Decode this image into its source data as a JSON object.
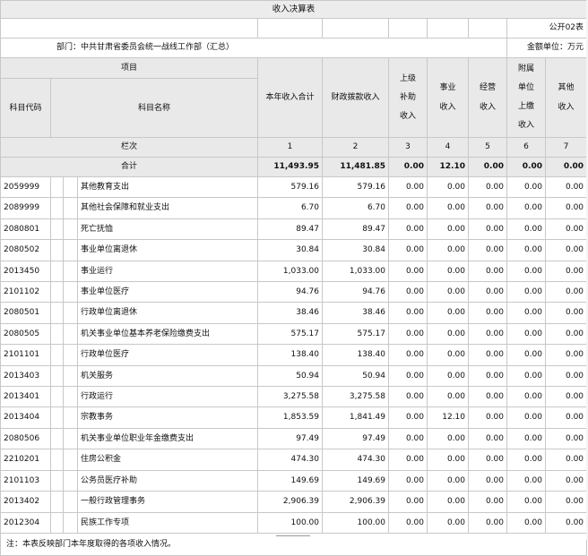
{
  "title": "收入决算表",
  "form_no": "公开02表",
  "department": "部门：中共甘肃省委员会统一战线工作部（汇总）",
  "unit": "金额单位：万元",
  "headers": {
    "item": "项目",
    "code": "科目代码",
    "name": "科目名称",
    "total": "本年收入合计",
    "fiscal": "财政拨款收入",
    "superior": "上级补助收入",
    "business": "事业收入",
    "operating": "经营收入",
    "affiliate": "附属单位上缴收入",
    "other": "其他收入"
  },
  "column_index_label": "栏次",
  "column_index": [
    "1",
    "2",
    "3",
    "4",
    "5",
    "6",
    "7"
  ],
  "total_row": {
    "label": "合计",
    "values": [
      "11,493.95",
      "11,481.85",
      "0.00",
      "12.10",
      "0.00",
      "0.00",
      "0.00"
    ]
  },
  "rows": [
    {
      "code": "2059999",
      "name": "其他教育支出",
      "values": [
        "579.16",
        "579.16",
        "0.00",
        "0.00",
        "0.00",
        "0.00",
        "0.00"
      ]
    },
    {
      "code": "2089999",
      "name": "其他社会保障和就业支出",
      "values": [
        "6.70",
        "6.70",
        "0.00",
        "0.00",
        "0.00",
        "0.00",
        "0.00"
      ]
    },
    {
      "code": "2080801",
      "name": "死亡抚恤",
      "values": [
        "89.47",
        "89.47",
        "0.00",
        "0.00",
        "0.00",
        "0.00",
        "0.00"
      ]
    },
    {
      "code": "2080502",
      "name": "事业单位离退休",
      "values": [
        "30.84",
        "30.84",
        "0.00",
        "0.00",
        "0.00",
        "0.00",
        "0.00"
      ]
    },
    {
      "code": "2013450",
      "name": "事业运行",
      "values": [
        "1,033.00",
        "1,033.00",
        "0.00",
        "0.00",
        "0.00",
        "0.00",
        "0.00"
      ]
    },
    {
      "code": "2101102",
      "name": "事业单位医疗",
      "values": [
        "94.76",
        "94.76",
        "0.00",
        "0.00",
        "0.00",
        "0.00",
        "0.00"
      ]
    },
    {
      "code": "2080501",
      "name": "行政单位离退休",
      "values": [
        "38.46",
        "38.46",
        "0.00",
        "0.00",
        "0.00",
        "0.00",
        "0.00"
      ]
    },
    {
      "code": "2080505",
      "name": "机关事业单位基本养老保险缴费支出",
      "values": [
        "575.17",
        "575.17",
        "0.00",
        "0.00",
        "0.00",
        "0.00",
        "0.00"
      ]
    },
    {
      "code": "2101101",
      "name": "行政单位医疗",
      "values": [
        "138.40",
        "138.40",
        "0.00",
        "0.00",
        "0.00",
        "0.00",
        "0.00"
      ]
    },
    {
      "code": "2013403",
      "name": "机关服务",
      "values": [
        "50.94",
        "50.94",
        "0.00",
        "0.00",
        "0.00",
        "0.00",
        "0.00"
      ]
    },
    {
      "code": "2013401",
      "name": "行政运行",
      "values": [
        "3,275.58",
        "3,275.58",
        "0.00",
        "0.00",
        "0.00",
        "0.00",
        "0.00"
      ]
    },
    {
      "code": "2013404",
      "name": "宗教事务",
      "values": [
        "1,853.59",
        "1,841.49",
        "0.00",
        "12.10",
        "0.00",
        "0.00",
        "0.00"
      ]
    },
    {
      "code": "2080506",
      "name": "机关事业单位职业年金缴费支出",
      "values": [
        "97.49",
        "97.49",
        "0.00",
        "0.00",
        "0.00",
        "0.00",
        "0.00"
      ]
    },
    {
      "code": "2210201",
      "name": "住房公积金",
      "values": [
        "474.30",
        "474.30",
        "0.00",
        "0.00",
        "0.00",
        "0.00",
        "0.00"
      ]
    },
    {
      "code": "2101103",
      "name": "公务员医疗补助",
      "values": [
        "149.69",
        "149.69",
        "0.00",
        "0.00",
        "0.00",
        "0.00",
        "0.00"
      ]
    },
    {
      "code": "2013402",
      "name": "一般行政管理事务",
      "values": [
        "2,906.39",
        "2,906.39",
        "0.00",
        "0.00",
        "0.00",
        "0.00",
        "0.00"
      ]
    },
    {
      "code": "2012304",
      "name": "民族工作专项",
      "values": [
        "100.00",
        "100.00",
        "0.00",
        "0.00",
        "0.00",
        "0.00",
        "0.00"
      ]
    }
  ],
  "note": "注：本表反映部门本年度取得的各项收入情况。"
}
